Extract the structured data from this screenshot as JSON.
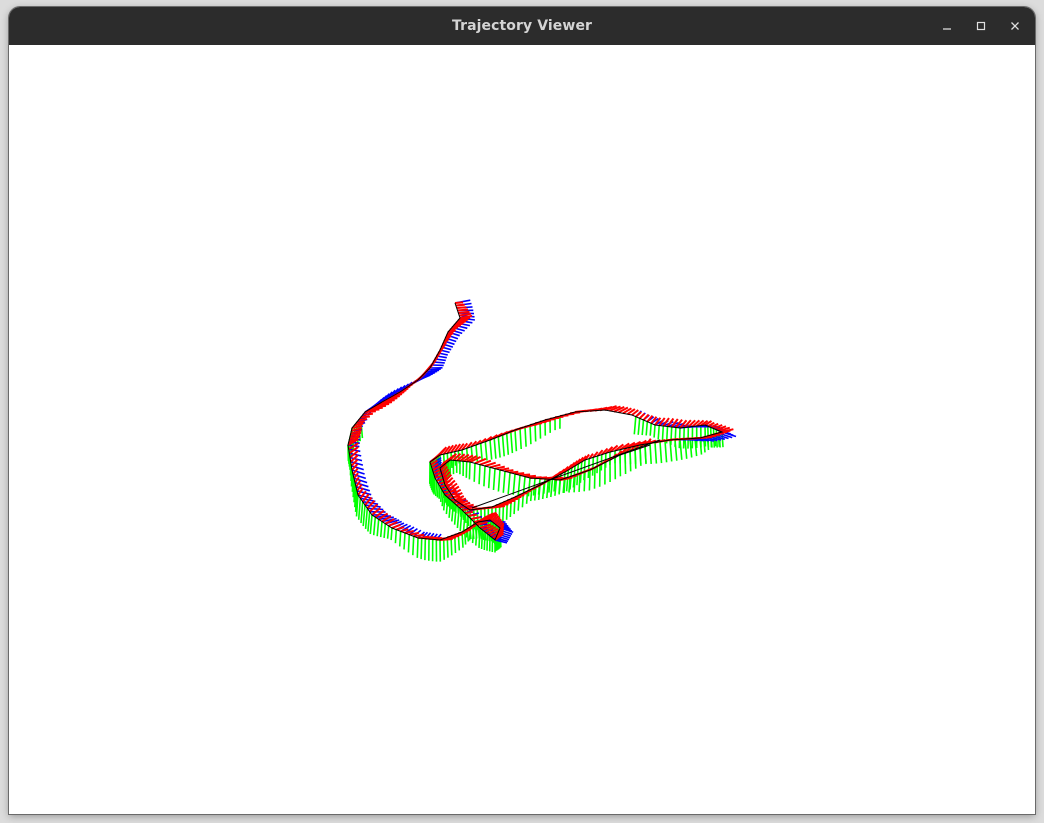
{
  "window": {
    "title": "Trajectory Viewer",
    "controls": {
      "minimize_icon": "minimize-icon",
      "maximize_icon": "maximize-icon",
      "close_icon": "close-icon"
    }
  },
  "viewer": {
    "background": "#ffffff",
    "axis_colors": {
      "x": "#ff0000",
      "y": "#00ff00",
      "z": "#0000ff"
    },
    "path_color": "#000000"
  }
}
